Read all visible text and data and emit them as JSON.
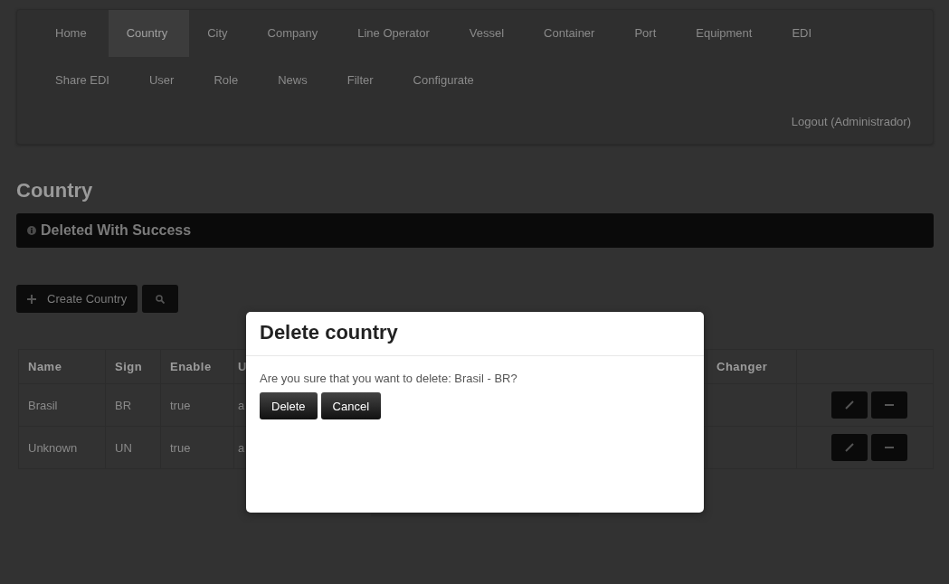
{
  "navbar": {
    "items": [
      {
        "label": "Home",
        "selected": false
      },
      {
        "label": "Country",
        "selected": true
      },
      {
        "label": "City",
        "selected": false
      },
      {
        "label": "Company",
        "selected": false
      },
      {
        "label": "Line Operator",
        "selected": false
      },
      {
        "label": "Vessel",
        "selected": false
      },
      {
        "label": "Container",
        "selected": false
      },
      {
        "label": "Port",
        "selected": false
      },
      {
        "label": "Equipment",
        "selected": false
      },
      {
        "label": "EDI",
        "selected": false
      },
      {
        "label": "Share EDI",
        "selected": false
      },
      {
        "label": "User",
        "selected": false
      },
      {
        "label": "Role",
        "selected": false
      },
      {
        "label": "News",
        "selected": false
      },
      {
        "label": "Filter",
        "selected": false
      },
      {
        "label": "Configurate",
        "selected": false
      }
    ],
    "logout": "Logout (Administrador)"
  },
  "page_title": "Country",
  "alert": {
    "text": "Deleted With Success"
  },
  "toolbar": {
    "create_button": "Create Country"
  },
  "table": {
    "columns": [
      "Name",
      "Sign",
      "Enable",
      "U",
      "Changer",
      ""
    ],
    "rows": [
      {
        "cells": [
          "Brasil",
          "BR",
          "true",
          "a",
          ""
        ]
      },
      {
        "cells": [
          "Unknown",
          "UN",
          "true",
          "a",
          ""
        ]
      }
    ]
  },
  "dialog": {
    "title": "Delete country",
    "message": "Are you sure that you want to delete: Brasil - BR?",
    "buttons": [
      "Delete",
      "Cancel"
    ]
  }
}
